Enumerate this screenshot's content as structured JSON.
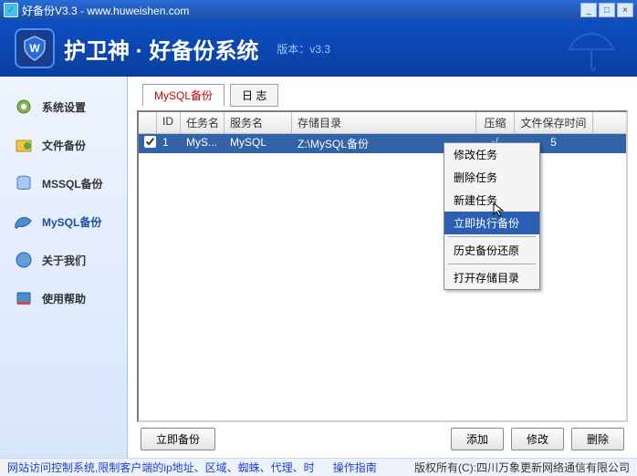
{
  "window": {
    "title": "好备份V3.3 - www.huweishen.com",
    "min_icon": "_",
    "max_icon": "□",
    "close_icon": "×"
  },
  "header": {
    "product_name": "护卫神 · 好备份系统",
    "version_label": "版本：v3.3"
  },
  "sidebar": {
    "items": [
      {
        "icon": "gear-icon",
        "label": "系统设置"
      },
      {
        "icon": "folder-icon",
        "label": "文件备份"
      },
      {
        "icon": "db-blue-icon",
        "label": "MSSQL备份"
      },
      {
        "icon": "dolphin-icon",
        "label": "MySQL备份"
      },
      {
        "icon": "globe-icon",
        "label": "关于我们"
      },
      {
        "icon": "book-icon",
        "label": "使用帮助"
      }
    ],
    "active_index": 3
  },
  "tabs": {
    "items": [
      "MySQL备份",
      "日 志"
    ],
    "active_index": 0
  },
  "table": {
    "headers": {
      "id": "ID",
      "task": "任务名",
      "service": "服务名",
      "path": "存储目录",
      "zip": "压缩",
      "keep": "文件保存时间"
    },
    "rows": [
      {
        "checked": true,
        "id": "1",
        "task": "MyS...",
        "service": "MySQL",
        "path": "Z:\\MySQL备份",
        "zip": "√",
        "keep": "5"
      }
    ]
  },
  "context_menu": {
    "items": [
      {
        "label": "修改任务"
      },
      {
        "label": "删除任务"
      },
      {
        "label": "新建任务"
      },
      {
        "label": "立即执行备份",
        "highlight": true
      },
      {
        "sep": true
      },
      {
        "label": "历史备份还原"
      },
      {
        "sep": true
      },
      {
        "label": "打开存储目录"
      }
    ]
  },
  "footer_buttons": {
    "backup_now": "立即备份",
    "add": "添加",
    "edit": "修改",
    "delete": "删除"
  },
  "statusbar": {
    "link1": "网站访问控制系统,限制客户端的ip地址、区域、蜘蛛、代理、时",
    "link2": "操作指南",
    "copyright": "版权所有(C):四川万象更新网络通信有限公司"
  }
}
